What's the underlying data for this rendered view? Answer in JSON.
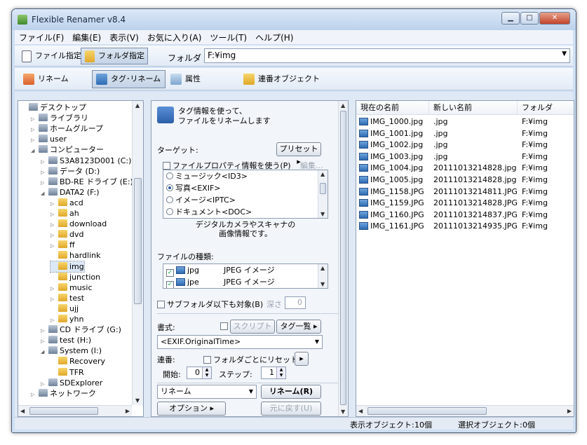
{
  "window": {
    "title": "Flexible Renamer v8.4",
    "controls": [
      "▁",
      "□",
      "✕"
    ]
  },
  "menu": [
    "ファイル(F)",
    "編集(E)",
    "表示(V)",
    "お気に入り(A)",
    "ツール(T)",
    "ヘルプ(H)"
  ],
  "toolbar1": {
    "file_mode": "ファイル指定",
    "folder_mode": "フォルダ指定",
    "folder_label": "フォルダ",
    "folder_path": "F:¥img"
  },
  "toolbar2": {
    "rename": "リネーム",
    "tag_rename": "タグ･リネーム",
    "attributes": "属性",
    "sequential": "連番オブジェクト"
  },
  "tree": [
    {
      "label": "デスクトップ",
      "indent": 0,
      "exp": ""
    },
    {
      "label": "ライブラリ",
      "indent": 1,
      "exp": "▷"
    },
    {
      "label": "ホームグループ",
      "indent": 1,
      "exp": "▷"
    },
    {
      "label": "user",
      "indent": 1,
      "exp": "▷"
    },
    {
      "label": "コンピューター",
      "indent": 1,
      "exp": "◢"
    },
    {
      "label": "S3A8123D001 (C:)",
      "indent": 2,
      "exp": "▷"
    },
    {
      "label": "データ (D:)",
      "indent": 2,
      "exp": "▷"
    },
    {
      "label": "BD-RE ドライブ (E:) /",
      "indent": 2,
      "exp": "▷"
    },
    {
      "label": "DATA2 (F:)",
      "indent": 2,
      "exp": "◢"
    },
    {
      "label": "acd",
      "indent": 3,
      "exp": "▷"
    },
    {
      "label": "ah",
      "indent": 3,
      "exp": "▷"
    },
    {
      "label": "download",
      "indent": 3,
      "exp": "▷"
    },
    {
      "label": "dvd",
      "indent": 3,
      "exp": "▷"
    },
    {
      "label": "ff",
      "indent": 3,
      "exp": "▷"
    },
    {
      "label": "hardlink",
      "indent": 3,
      "exp": ""
    },
    {
      "label": "img",
      "indent": 3,
      "exp": ""
    },
    {
      "label": "junction",
      "indent": 3,
      "exp": ""
    },
    {
      "label": "music",
      "indent": 3,
      "exp": "▷"
    },
    {
      "label": "test",
      "indent": 3,
      "exp": "▷"
    },
    {
      "label": "ujj",
      "indent": 3,
      "exp": ""
    },
    {
      "label": "yhn",
      "indent": 3,
      "exp": "▷"
    },
    {
      "label": "CD ドライブ (G:)",
      "indent": 2,
      "exp": "▷"
    },
    {
      "label": "test (H:)",
      "indent": 2,
      "exp": "▷"
    },
    {
      "label": "System (I:)",
      "indent": 2,
      "exp": "◢"
    },
    {
      "label": "Recovery",
      "indent": 3,
      "exp": ""
    },
    {
      "label": "TFR",
      "indent": 3,
      "exp": ""
    },
    {
      "label": "SDExplorer",
      "indent": 2,
      "exp": "▷"
    },
    {
      "label": "ネットワーク",
      "indent": 1,
      "exp": "▷"
    }
  ],
  "middle": {
    "desc_line1": "タグ情報を使って、",
    "desc_line2": "ファイルをリネームします",
    "target_label": "ターゲット:",
    "preset_button": "プリセット ▸",
    "use_file_props": "ファイルプロパティ情報を使う(P)",
    "edit_link": "編集...",
    "tag_types": [
      "ミュージック<ID3>",
      "写真<EXIF>",
      "イメージ<IPTC>",
      "ドキュメント<DOC>"
    ],
    "type_desc_line1": "デジタルカメラやスキャナの",
    "type_desc_line2": "画像情報です。",
    "file_type_label": "ファイルの種類:",
    "file_types": [
      {
        "ext": "jpg",
        "desc": "JPEG イメージ"
      },
      {
        "ext": "jpe",
        "desc": "JPEG イメージ"
      }
    ],
    "subfolder_label": "サブフォルダ以下も対象(B)",
    "depth_label": "深さ",
    "depth_value": "0",
    "format_label": "書式:",
    "script_button": "スクリプト ▸",
    "tag_list_button": "タグ一覧 ▸",
    "format_value": "<EXIF.OriginalTime>",
    "seq_label": "連番:",
    "reset_per_folder": "フォルダごとにリセット",
    "start_label": "開始:",
    "start_value": "0",
    "step_label": "ステップ:",
    "step_value": "1",
    "action_select": "リネーム",
    "rename_button": "リネーム(R)",
    "options_button": "オプション ▸",
    "undo_button": "元に戻す(U)"
  },
  "list": {
    "headers": [
      "現在の名前",
      "新しい名前",
      "フォルダ"
    ],
    "rows": [
      [
        "IMG_1000.jpg",
        ".jpg",
        "F:¥img"
      ],
      [
        "IMG_1001.jpg",
        ".jpg",
        "F:¥img"
      ],
      [
        "IMG_1002.jpg",
        ".jpg",
        "F:¥img"
      ],
      [
        "IMG_1003.jpg",
        ".jpg",
        "F:¥img"
      ],
      [
        "IMG_1004.jpg",
        "20111013214828.jpg",
        "F:¥img"
      ],
      [
        "IMG_1005.jpg",
        "20111013214828.jpg",
        "F:¥img"
      ],
      [
        "IMG_1158.JPG",
        "20111013214811.JPG",
        "F:¥img"
      ],
      [
        "IMG_1159.JPG",
        "20111013214828.JPG",
        "F:¥img"
      ],
      [
        "IMG_1160.JPG",
        "20111013214837.JPG",
        "F:¥img"
      ],
      [
        "IMG_1161.JPG",
        "20111013214935.JPG",
        "F:¥img"
      ]
    ]
  },
  "status": {
    "shown_label": "表示オブジェクト:",
    "shown_value": "10個",
    "selected_label": "選択オブジェクト:",
    "selected_value": "0個"
  }
}
